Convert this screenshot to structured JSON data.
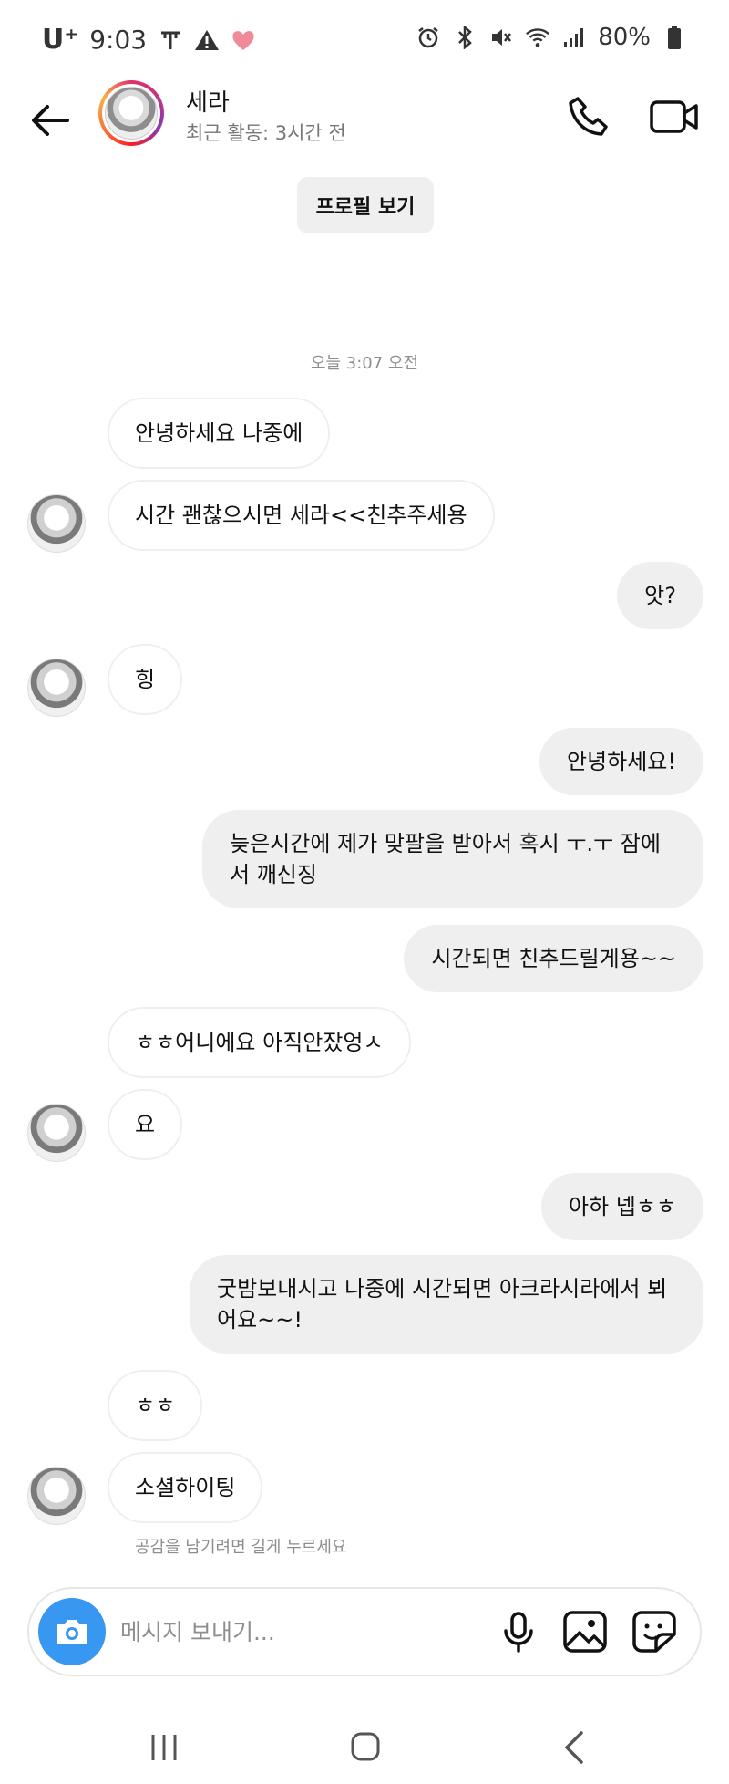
{
  "status_bar": {
    "carrier": "U⁺",
    "time": "9:03",
    "battery": "80%"
  },
  "header": {
    "name": "세라",
    "subtitle": "최근 활동: 3시간 전"
  },
  "profile_button": "프로필 보기",
  "timestamp": "오늘 3:07 오전",
  "messages": [
    {
      "dir": "in",
      "text": "안녕하세요 나중에"
    },
    {
      "dir": "in",
      "text": "시간 괜찮으시면 세라<<친추주세용"
    },
    {
      "dir": "out",
      "text": "앗?"
    },
    {
      "dir": "in",
      "text": "힝"
    },
    {
      "dir": "out",
      "text": "안녕하세요!"
    },
    {
      "dir": "out",
      "text": "늦은시간에 제가 맞팔을 받아서 혹시 ㅜ.ㅜ 잠에서 깨신징"
    },
    {
      "dir": "out",
      "text": "시간되면 친추드릴게용~~"
    },
    {
      "dir": "in",
      "text": "ㅎㅎ어니에요 아직안잤엉ㅅ"
    },
    {
      "dir": "in",
      "text": "요"
    },
    {
      "dir": "out",
      "text": "아하 넵ㅎㅎ"
    },
    {
      "dir": "out",
      "text": "굿밤보내시고 나중에 시간되면 아크라시라에서 뵈어요~~!"
    },
    {
      "dir": "in",
      "text": "ㅎㅎ"
    },
    {
      "dir": "in",
      "text": "소셜하이팅"
    }
  ],
  "reaction_hint": "공감을 남기려면 길게 누르세요",
  "composer": {
    "placeholder": "메시지 보내기..."
  },
  "colors": {
    "accent": "#3897f0",
    "outgoing_bubble": "#efefef",
    "muted_text": "#8e8e8e"
  },
  "icons": [
    "back-arrow-icon",
    "phone-icon",
    "video-camera-icon",
    "camera-icon",
    "microphone-icon",
    "gallery-icon",
    "sticker-icon",
    "recent-apps-icon",
    "home-icon",
    "nav-back-icon"
  ]
}
